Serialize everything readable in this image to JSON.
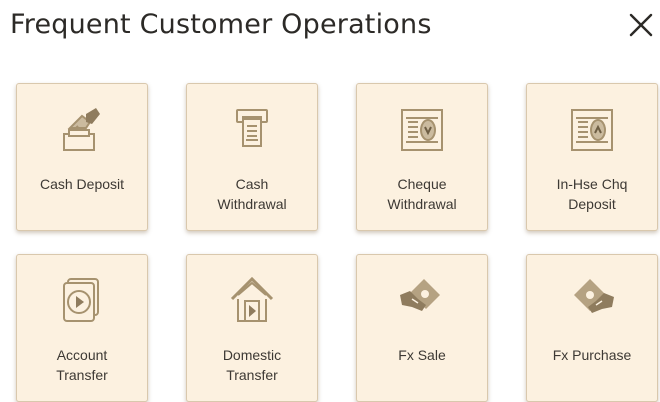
{
  "dialog": {
    "title": "Frequent Customer Operations",
    "close_label": "×"
  },
  "colors": {
    "tile_background": "#fcf1e0",
    "tile_border": "#d9c8ad",
    "icon_color": "#a6926f",
    "text_color": "#3d3934"
  },
  "tiles": [
    {
      "label_line1": "Cash Deposit",
      "label_line2": "",
      "icon": "cash-deposit-icon"
    },
    {
      "label_line1": "Cash",
      "label_line2": "Withdrawal",
      "icon": "cash-withdrawal-icon"
    },
    {
      "label_line1": "Cheque",
      "label_line2": "Withdrawal",
      "icon": "cheque-withdrawal-icon"
    },
    {
      "label_line1": "In-Hse Chq",
      "label_line2": "Deposit",
      "icon": "inhouse-cheque-deposit-icon"
    },
    {
      "label_line1": "Account",
      "label_line2": "Transfer",
      "icon": "account-transfer-icon"
    },
    {
      "label_line1": "Domestic",
      "label_line2": "Transfer",
      "icon": "domestic-transfer-icon"
    },
    {
      "label_line1": "Fx Sale",
      "label_line2": "",
      "icon": "fx-sale-icon"
    },
    {
      "label_line1": "Fx Purchase",
      "label_line2": "",
      "icon": "fx-purchase-icon"
    }
  ]
}
